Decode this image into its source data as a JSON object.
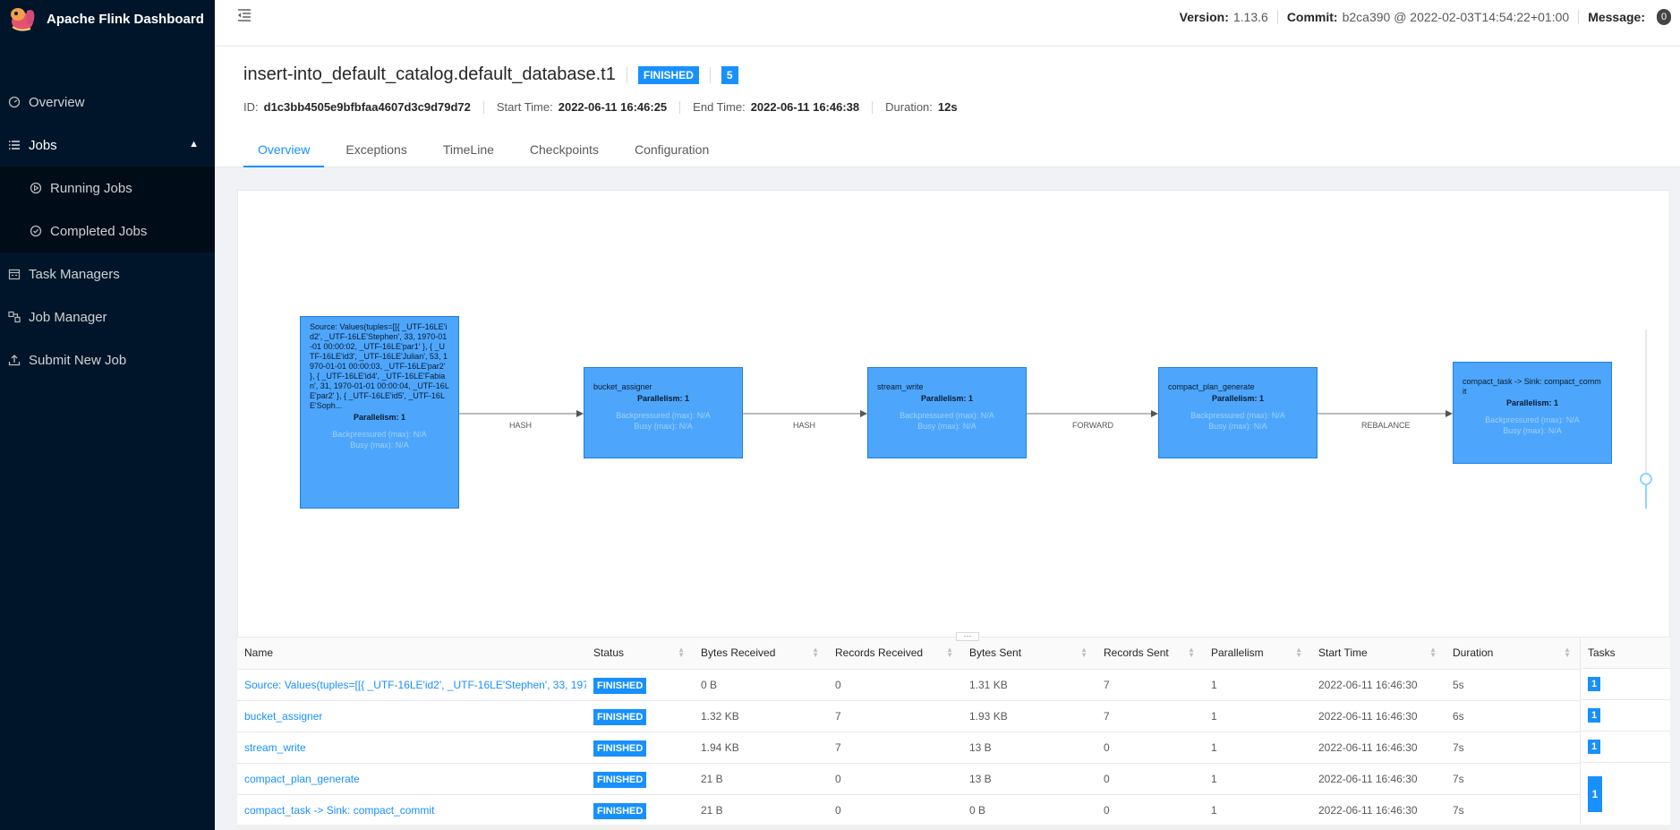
{
  "app": {
    "title": "Apache Flink Dashboard"
  },
  "sidebar": {
    "items": [
      {
        "label": "Overview",
        "icon": "dashboard-icon"
      },
      {
        "label": "Jobs",
        "icon": "list-icon"
      },
      {
        "label": "Running Jobs",
        "icon": "play-circle-icon"
      },
      {
        "label": "Completed Jobs",
        "icon": "check-circle-icon"
      },
      {
        "label": "Task Managers",
        "icon": "schedule-icon"
      },
      {
        "label": "Job Manager",
        "icon": "cluster-icon"
      },
      {
        "label": "Submit New Job",
        "icon": "upload-icon"
      }
    ]
  },
  "header": {
    "version_label": "Version:",
    "version": "1.13.6",
    "commit_label": "Commit:",
    "commit": "b2ca390 @ 2022-02-03T14:54:22+01:00",
    "message_label": "Message:",
    "message_count": "0"
  },
  "job": {
    "title": "insert-into_default_catalog.default_database.t1",
    "status": "FINISHED",
    "task_count": "5",
    "id_label": "ID:",
    "id": "d1c3bb4505e9bfbfaa4607d3c9d79d72",
    "start_label": "Start Time:",
    "start": "2022-06-11 16:46:25",
    "end_label": "End Time:",
    "end": "2022-06-11 16:46:38",
    "duration_label": "Duration:",
    "duration": "12s"
  },
  "tabs": [
    "Overview",
    "Exceptions",
    "TimeLine",
    "Checkpoints",
    "Configuration"
  ],
  "graph": {
    "nodes": [
      {
        "name": "Source: Values(tuples=[[{ _UTF-16LE'id2', _UTF-16LE'Stephen', 33, 1970-01-01 00:00:02, _UTF-16LE'par1' }, { _UTF-16LE'id3', _UTF-16LE'Julian', 53, 1970-01-01 00:00:03, _UTF-16LE'par2' }, { _UTF-16LE'id4', _UTF-16LE'Fabian', 31, 1970-01-01 00:00:04, _UTF-16LE'par2' }, { _UTF-16LE'id5', _UTF-16LE'Soph...",
        "parallelism": "Parallelism: 1",
        "backpressured": "Backpressured (max): N/A",
        "busy": "Busy (max): N/A"
      },
      {
        "name": "bucket_assigner",
        "parallelism": "Parallelism: 1",
        "backpressured": "Backpressured (max): N/A",
        "busy": "Busy (max): N/A"
      },
      {
        "name": "stream_write",
        "parallelism": "Parallelism: 1",
        "backpressured": "Backpressured (max): N/A",
        "busy": "Busy (max): N/A"
      },
      {
        "name": "compact_plan_generate",
        "parallelism": "Parallelism: 1",
        "backpressured": "Backpressured (max): N/A",
        "busy": "Busy (max): N/A"
      },
      {
        "name": "compact_task -> Sink: compact_commit",
        "parallelism": "Parallelism: 1",
        "backpressured": "Backpressured (max): N/A",
        "busy": "Busy (max): N/A"
      }
    ],
    "edges": [
      "HASH",
      "HASH",
      "FORWARD",
      "REBALANCE"
    ]
  },
  "table": {
    "headers": [
      "Name",
      "Status",
      "Bytes Received",
      "Records Received",
      "Bytes Sent",
      "Records Sent",
      "Parallelism",
      "Start Time",
      "Duration",
      "Tasks"
    ],
    "rows": [
      {
        "name": "Source: Values(tuples=[[{ _UTF-16LE'id2', _UTF-16LE'Stephen', 33, 197...",
        "status": "FINISHED",
        "bytes_received": "0 B",
        "records_received": "0",
        "bytes_sent": "1.31 KB",
        "records_sent": "7",
        "parallelism": "1",
        "start_time": "2022-06-11 16:46:30",
        "duration": "5s",
        "tasks": "1"
      },
      {
        "name": "bucket_assigner",
        "status": "FINISHED",
        "bytes_received": "1.32 KB",
        "records_received": "7",
        "bytes_sent": "1.93 KB",
        "records_sent": "7",
        "parallelism": "1",
        "start_time": "2022-06-11 16:46:30",
        "duration": "6s",
        "tasks": "1"
      },
      {
        "name": "stream_write",
        "status": "FINISHED",
        "bytes_received": "1.94 KB",
        "records_received": "7",
        "bytes_sent": "13 B",
        "records_sent": "0",
        "parallelism": "1",
        "start_time": "2022-06-11 16:46:30",
        "duration": "7s",
        "tasks": "1"
      },
      {
        "name": "compact_plan_generate",
        "status": "FINISHED",
        "bytes_received": "21 B",
        "records_received": "0",
        "bytes_sent": "13 B",
        "records_sent": "0",
        "parallelism": "1",
        "start_time": "2022-06-11 16:46:30",
        "duration": "7s",
        "tasks": ""
      },
      {
        "name": "compact_task -> Sink: compact_commit",
        "status": "FINISHED",
        "bytes_received": "21 B",
        "records_received": "0",
        "bytes_sent": "0 B",
        "records_sent": "0",
        "parallelism": "1",
        "start_time": "2022-06-11 16:46:30",
        "duration": "7s",
        "tasks": "1"
      }
    ]
  },
  "colors": {
    "accent": "#1890ff",
    "sidebar": "#001529",
    "node": "#4da6fb"
  }
}
